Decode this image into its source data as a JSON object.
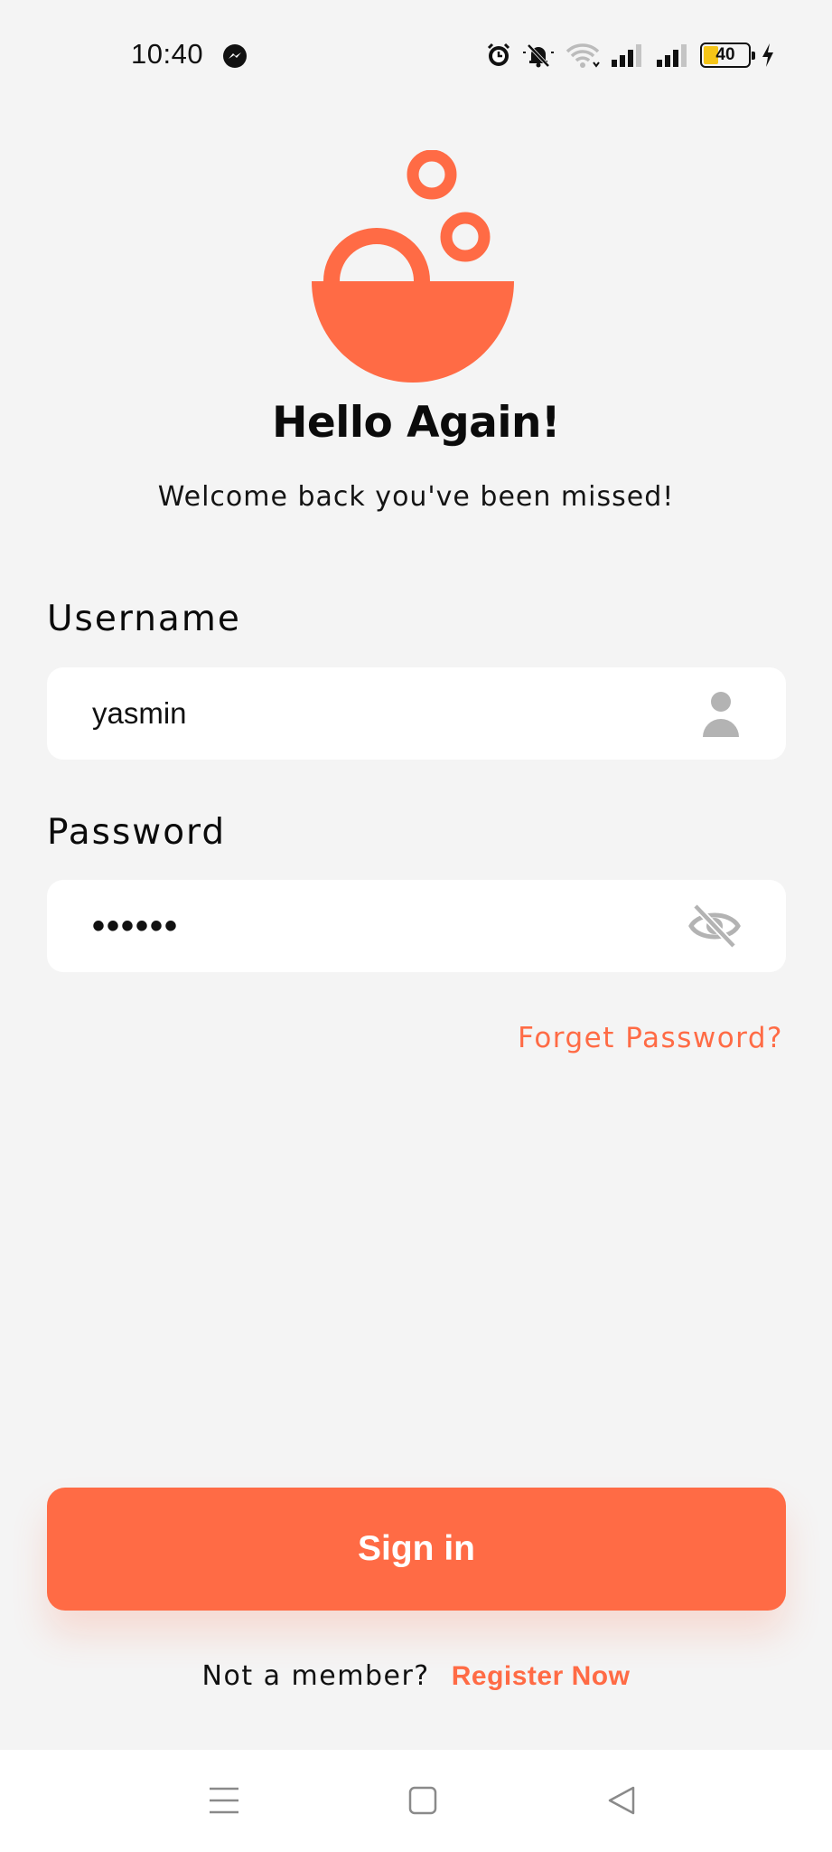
{
  "status_bar": {
    "time": "10:40",
    "battery_level": "40"
  },
  "title": "Hello Again!",
  "subtitle": "Welcome back you've been missed!",
  "username": {
    "label": "Username",
    "value": "yasmin"
  },
  "password": {
    "label": "Password",
    "value": "••••••"
  },
  "forgot_password": "Forget Password?",
  "signin_button": "Sign in",
  "register": {
    "prompt": "Not a member?",
    "link": "Register Now"
  },
  "colors": {
    "accent": "#ff6b45",
    "background": "#f4f4f4",
    "input_background": "#ffffff"
  },
  "icons": {
    "username_field": "person-icon",
    "password_field": "eye-off-icon",
    "status": [
      "messenger-icon",
      "alarm-icon",
      "bell-off-icon",
      "wifi-icon",
      "signal-icon",
      "signal-icon",
      "battery-icon",
      "charging-icon"
    ],
    "navigation": [
      "menu-icon",
      "home-icon",
      "back-icon"
    ]
  }
}
